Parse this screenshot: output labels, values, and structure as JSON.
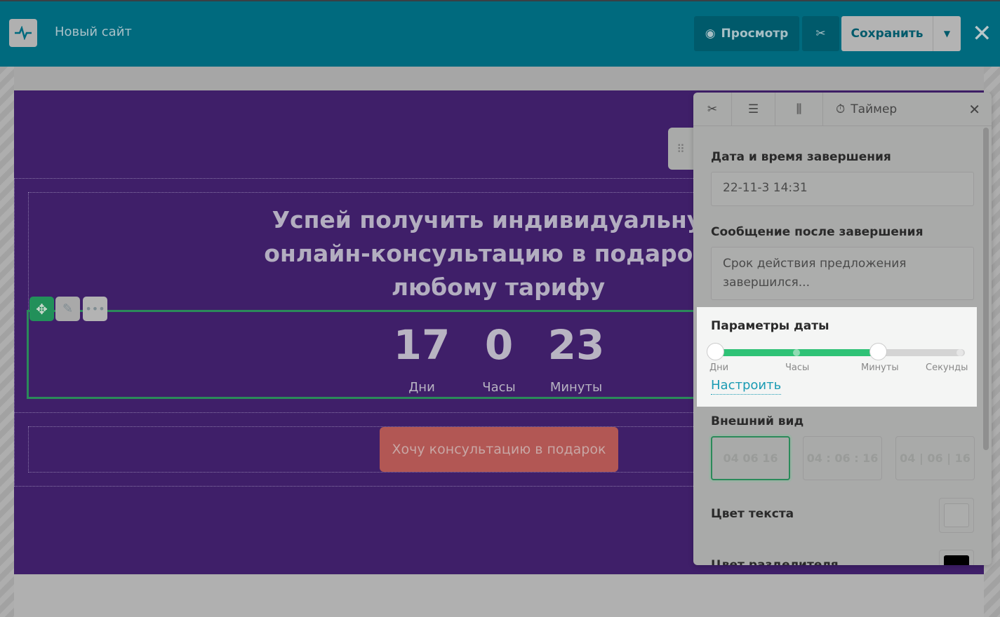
{
  "header": {
    "site_title": "Новый сайт",
    "preview_label": "Просмотр",
    "save_label": "Сохранить"
  },
  "block": {
    "headline": "Успей получить индивидуальную онлайн-консультацию в подарок к любому тарифу",
    "timer": [
      {
        "value": "17",
        "label": "Дни"
      },
      {
        "value": "0",
        "label": "Часы"
      },
      {
        "value": "23",
        "label": "Минуты"
      }
    ],
    "cta_label": "Хочу консультацию в подарок"
  },
  "panel": {
    "tab_title": "Таймер",
    "end_date_label": "Дата и время завершения",
    "end_date_value": "22-11-3 14:31",
    "message_label": "Сообщение после завершения",
    "message_value": "Срок действия предложения завершился...",
    "date_params_label": "Параметры даты",
    "slider_stops": [
      "Дни",
      "Часы",
      "Минуты",
      "Секунды"
    ],
    "slider_range": {
      "from": "Дни",
      "to": "Минуты"
    },
    "configure_link": "Настроить",
    "appearance_label": "Внешний вид",
    "styles": [
      "04   06   16",
      "04 : 06 : 16",
      "04 | 06 | 16"
    ],
    "text_color_label": "Цвет текста",
    "divider_color_label": "Цвет разделителя",
    "colors": {
      "text": "#d8d8d8",
      "divider": "#000000"
    }
  },
  "colors": {
    "header": "#006a7e",
    "section": "#3f1f69",
    "accent": "#2fc276",
    "link": "#1a9bb3"
  }
}
